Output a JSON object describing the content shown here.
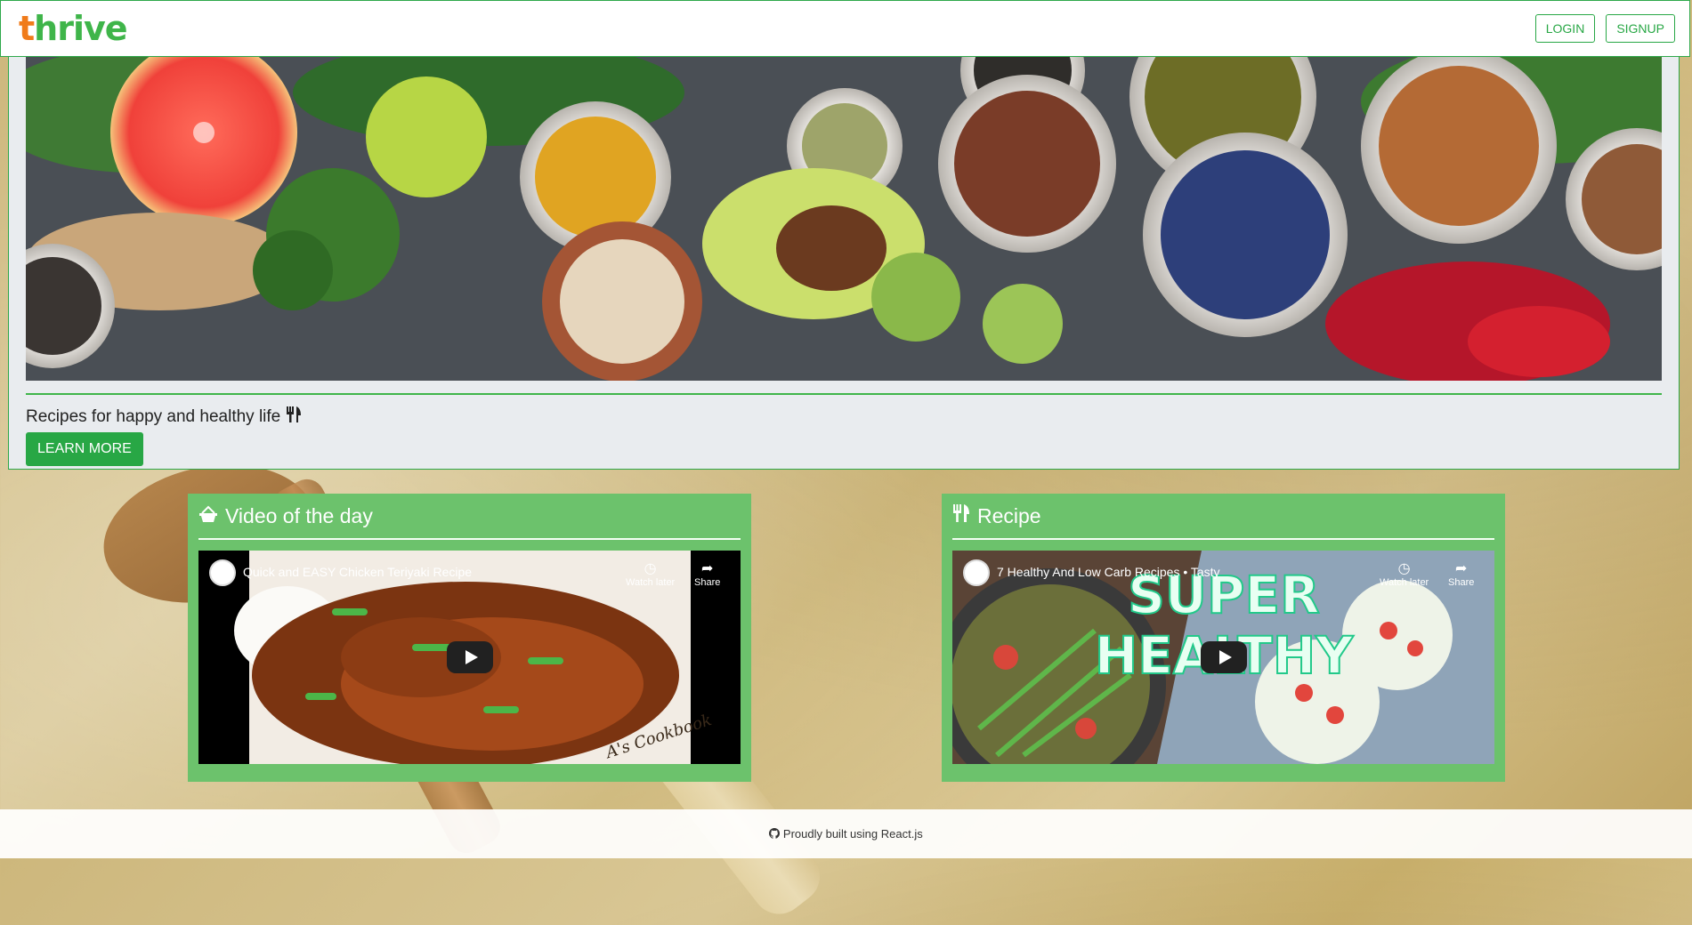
{
  "navbar": {
    "logo_t": "t",
    "logo_rest": "hrive",
    "login_label": "LOGIN",
    "signup_label": "SIGNUP"
  },
  "hero": {
    "tagline": "Recipes for happy and healthy life",
    "learn_more_label": "LEARN MORE"
  },
  "cards": [
    {
      "title": "Video of the day",
      "icon": "shopping-basket-icon",
      "video_title": "Quick and EASY Chicken Teriyaki Recipe",
      "watch_later": "Watch later",
      "share": "Share",
      "overlay_text": "A's Cookbook"
    },
    {
      "title": "Recipe",
      "icon": "utensils-icon",
      "video_title": "7 Healthy And Low Carb Recipes • Tasty",
      "watch_later": "Watch later",
      "share": "Share",
      "overlay_line1": "SUPER",
      "overlay_line2": "HEALTHY"
    }
  ],
  "footer": {
    "text": "Proudly built using React.js",
    "icon": "github-icon"
  },
  "colors": {
    "brand_green": "#28a745",
    "logo_orange": "#f07b1a",
    "card_green": "#6cc26c"
  }
}
